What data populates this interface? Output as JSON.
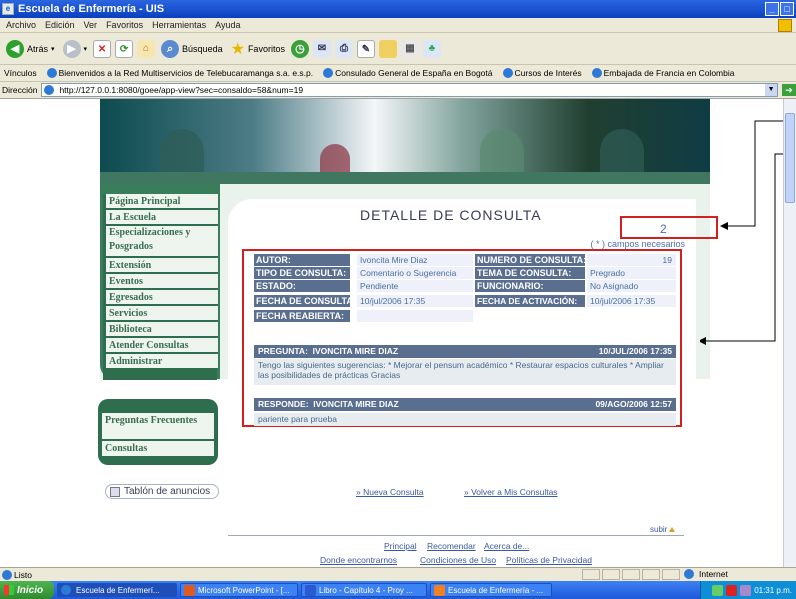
{
  "window": {
    "title": "Escuela de Enfermería - UIS"
  },
  "menu": [
    "Archivo",
    "Edición",
    "Ver",
    "Favoritos",
    "Herramientas",
    "Ayuda"
  ],
  "toolbar": {
    "back": "Atrás",
    "search": "Búsqueda",
    "favorites": "Favoritos"
  },
  "links": {
    "label": "Vínculos",
    "items": [
      "Bienvenidos a la Red Multiservicios de Telebucaramanga s.a. e.s.p.",
      "Consulado General de España en Bogotá",
      "Cursos de Interés",
      "Embajada de Francia en Colombia"
    ]
  },
  "address": {
    "label": "Dirección",
    "url": "http://127.0.0.1:8080/goee/app-view?sec=consaldo=58&num=19"
  },
  "nav": [
    "Página Principal",
    "La Escuela",
    "Especializaciones y Posgrados",
    "Extensión",
    "Eventos",
    "Egresados",
    "Servicios",
    "Biblioteca",
    "Atender Consultas",
    "Administrar"
  ],
  "nav2": [
    "Preguntas Frecuentes",
    "Consultas"
  ],
  "page": {
    "title": "DETALLE DE CONSULTA",
    "annotation": "2",
    "required_note": "( * ) campos necesarios"
  },
  "detail": {
    "autor_label": "AUTOR:",
    "autor": "Ivoncita Mire Diaz",
    "numero_label": "NUMERO DE CONSULTA:",
    "numero": "19",
    "tipo_label": "TIPO DE CONSULTA:",
    "tipo": "Comentario o Sugerencia",
    "tema_label": "TEMA DE CONSULTA:",
    "tema": "Pregrado",
    "estado_label": "ESTADO:",
    "estado": "Pendiente",
    "funcionario_label": "FUNCIONARIO:",
    "funcionario": "No Asignado",
    "fecha_label": "FECHA DE CONSULTA:",
    "fecha": "10/jul/2006 17:35",
    "activacion_label": "FECHA DE ACTIVACIÓN:",
    "activacion": "10/jul/2006 17:35",
    "reabierta_label": "FECHA REABIERTA:",
    "reabierta": ""
  },
  "question": {
    "label": "PREGUNTA:",
    "author": "IVONCITA MIRE DIAZ",
    "date": "10/JUL/2006 17:35",
    "text": "Tengo las siguientes sugerencias: * Mejorar el pensum académico * Restaurar espacios culturales * Ampliar las posibilidades de prácticas Gracias"
  },
  "answer": {
    "label": "RESPONDE:",
    "author": "IVONCITA MIRE DIAZ",
    "date": "09/AGO/2006 12:57",
    "text": "pariente para prueba"
  },
  "board": "Tablón de anuncios",
  "actions": {
    "new": "Nueva Consulta",
    "back": "Volver a Mis Consultas"
  },
  "subir": "subir",
  "footer": {
    "row1": [
      "Principal",
      "Recomendar",
      "Acerca de..."
    ],
    "row2": [
      "Donde encontrarnos",
      "Condiciones de Uso",
      "Políticas de Privacidad"
    ]
  },
  "status": {
    "text": "Listo",
    "zone": "Internet"
  },
  "taskbar": {
    "start": "Inicio",
    "tasks": [
      "Escuela de Enfermerí...",
      "Microsoft PowerPoint - [...",
      "Libro - Capítulo 4 - Proy ...",
      "Escuela de Enfermería - ..."
    ],
    "time": "01:31 p.m."
  },
  "colors": {
    "nav_green": "#2e6e4e",
    "header_blue": "#5a6e90",
    "highlight_red": "#d02020"
  }
}
